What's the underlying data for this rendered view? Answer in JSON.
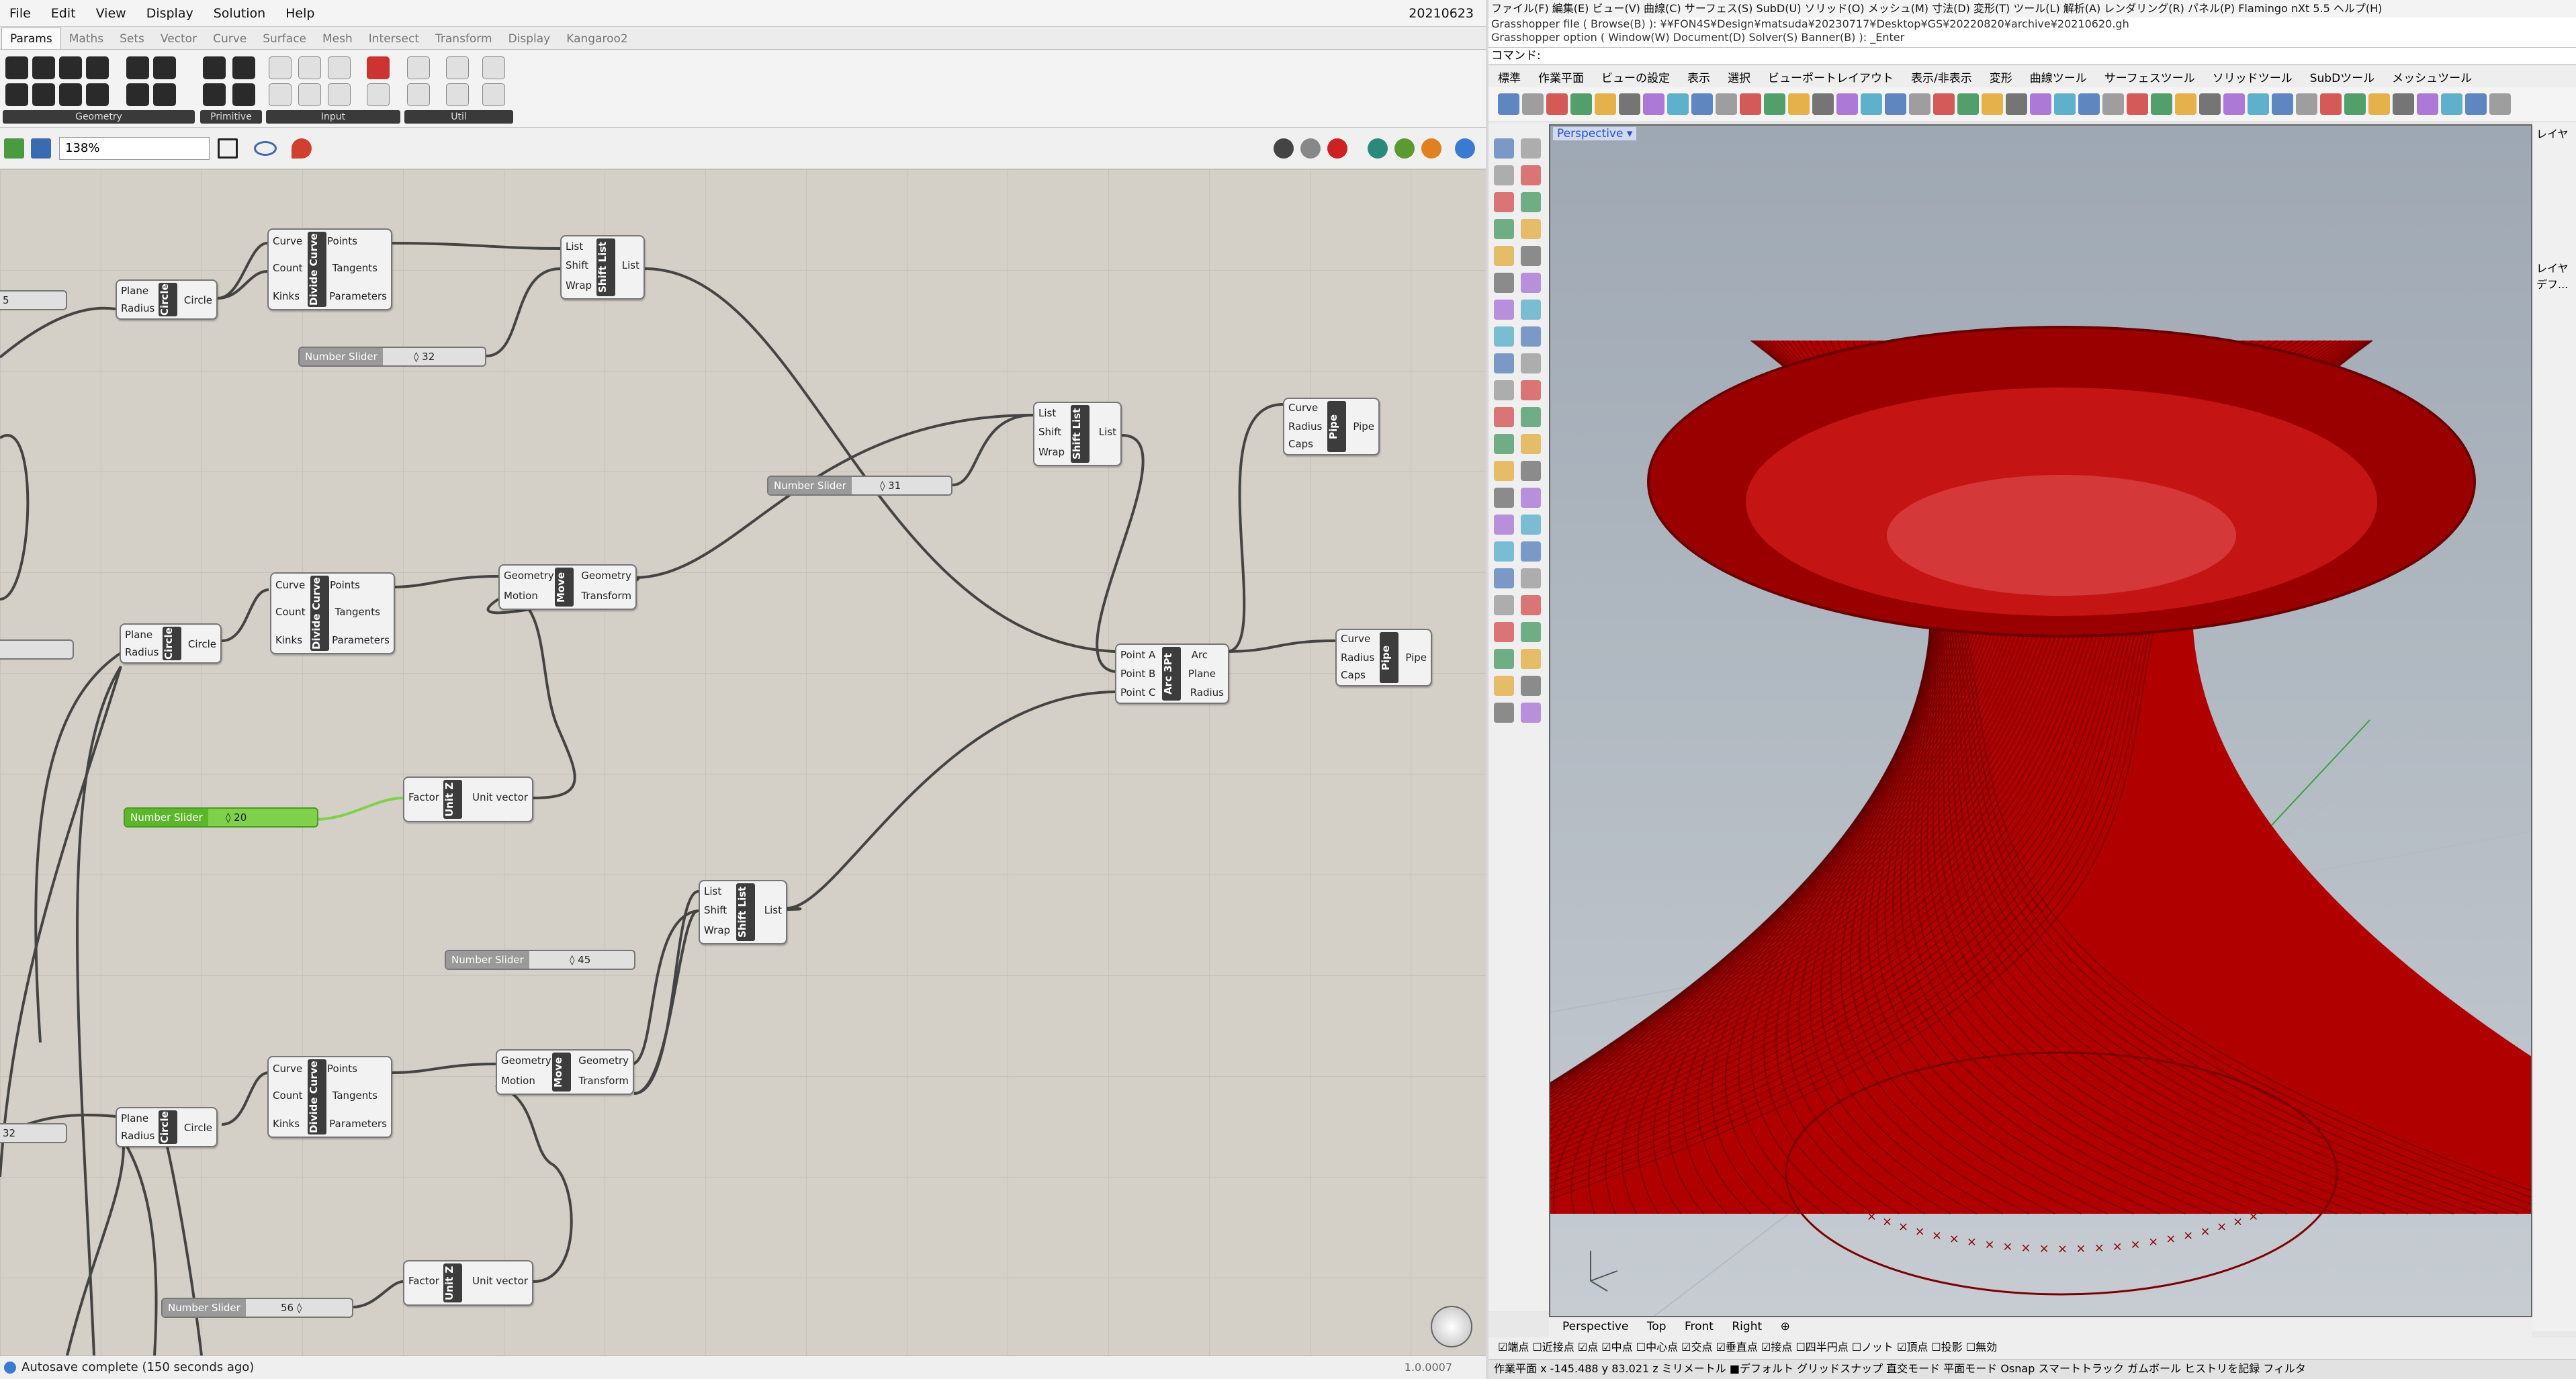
{
  "grasshopper": {
    "menu": [
      "File",
      "Edit",
      "View",
      "Display",
      "Solution",
      "Help"
    ],
    "date": "20210623",
    "tabs": [
      "Params",
      "Maths",
      "Sets",
      "Vector",
      "Curve",
      "Surface",
      "Mesh",
      "Intersect",
      "Transform",
      "Display",
      "Kangaroo2"
    ],
    "ribbon_groups": [
      "Geometry",
      "Primitive",
      "Input",
      "Util"
    ],
    "zoom": "138%",
    "components": [
      {
        "id": "circle1",
        "title": "Circle",
        "inputs": [
          "Plane",
          "Radius"
        ],
        "outputs": [
          "Circle"
        ]
      },
      {
        "id": "divide1",
        "title": "Divide Curve",
        "inputs": [
          "Curve",
          "Count",
          "Kinks"
        ],
        "outputs": [
          "Points",
          "Tangents",
          "Parameters"
        ]
      },
      {
        "id": "shift1",
        "title": "Shift List",
        "inputs": [
          "List",
          "Shift",
          "Wrap"
        ],
        "outputs": [
          "List"
        ]
      },
      {
        "id": "shift2",
        "title": "Shift List",
        "inputs": [
          "List",
          "Shift",
          "Wrap"
        ],
        "outputs": [
          "List"
        ]
      },
      {
        "id": "pipe1",
        "title": "Pipe",
        "inputs": [
          "Curve",
          "Radius",
          "Caps"
        ],
        "outputs": [
          "Pipe"
        ]
      },
      {
        "id": "circle2",
        "title": "Circle",
        "inputs": [
          "Plane",
          "Radius"
        ],
        "outputs": [
          "Circle"
        ]
      },
      {
        "id": "divide2",
        "title": "Divide Curve",
        "inputs": [
          "Curve",
          "Count",
          "Kinks"
        ],
        "outputs": [
          "Points",
          "Tangents",
          "Parameters"
        ]
      },
      {
        "id": "move1",
        "title": "Move",
        "inputs": [
          "Geometry",
          "Motion"
        ],
        "outputs": [
          "Geometry",
          "Transform"
        ]
      },
      {
        "id": "arc",
        "title": "Arc 3Pt",
        "inputs": [
          "Point A",
          "Point B",
          "Point C"
        ],
        "outputs": [
          "Arc",
          "Plane",
          "Radius"
        ]
      },
      {
        "id": "pipe2",
        "title": "Pipe",
        "inputs": [
          "Curve",
          "Radius",
          "Caps"
        ],
        "outputs": [
          "Pipe"
        ]
      },
      {
        "id": "unitz1",
        "title": "Unit Z",
        "inputs": [
          "Factor"
        ],
        "outputs": [
          "Unit vector"
        ]
      },
      {
        "id": "shift3",
        "title": "Shift List",
        "inputs": [
          "List",
          "Shift",
          "Wrap"
        ],
        "outputs": [
          "List"
        ]
      },
      {
        "id": "circle3",
        "title": "Circle",
        "inputs": [
          "Plane",
          "Radius"
        ],
        "outputs": [
          "Circle"
        ]
      },
      {
        "id": "divide3",
        "title": "Divide Curve",
        "inputs": [
          "Curve",
          "Count",
          "Kinks"
        ],
        "outputs": [
          "Points",
          "Tangents",
          "Parameters"
        ]
      },
      {
        "id": "move2",
        "title": "Move",
        "inputs": [
          "Geometry",
          "Motion"
        ],
        "outputs": [
          "Geometry",
          "Transform"
        ]
      },
      {
        "id": "unitz2",
        "title": "Unit Z",
        "inputs": [
          "Factor"
        ],
        "outputs": [
          "Unit vector"
        ]
      }
    ],
    "sliders": [
      {
        "id": "s32",
        "label": "Number Slider",
        "value": "◊ 32"
      },
      {
        "id": "s31",
        "label": "Number Slider",
        "value": "◊ 31"
      },
      {
        "id": "s20",
        "label": "Number Slider",
        "value": "◊ 20"
      },
      {
        "id": "s45",
        "label": "Number Slider",
        "value": "◊ 45"
      },
      {
        "id": "s56",
        "label": "Number Slider",
        "value": "56 ◊"
      }
    ],
    "edge_values": [
      "5",
      "32"
    ],
    "status": "Autosave complete (150 seconds ago)",
    "version": "1.0.0007"
  },
  "rhino": {
    "menu": "ファイル(F)  編集(E)  ビュー(V)  曲線(C)  サーフェス(S)  SubD(U)  ソリッド(O)  メッシュ(M)  寸法(D)  変形(T)  ツール(L)  解析(A)  レンダリング(R)  パネル(P)  Flamingo nXt 5.5  ヘルプ(H)",
    "history1": "Grasshopper file ( Browse(B) ): ¥¥FON4S¥Design¥matsuda¥20230717¥Desktop¥GS¥20220820¥archive¥20210620.gh",
    "history2": "Grasshopper option ( Window(W)  Document(D)  Solver(S)  Banner(B) ): _Enter",
    "command": "コマンド:",
    "tabs": [
      "標準",
      "作業平面",
      "ビューの設定",
      "表示",
      "選択",
      "ビューポートレイアウト",
      "表示/非表示",
      "変形",
      "曲線ツール",
      "サーフェスツール",
      "ソリッドツール",
      "SubDツール",
      "メッシュツール"
    ],
    "viewport_label": "Perspective ▾",
    "viewtabs": [
      "Perspective",
      "Top",
      "Front",
      "Right",
      "⊕"
    ],
    "osnaps": "☑端点  ☐近接点  ☑点  ☑中点  ☐中心点  ☑交点  ☑垂直点  ☑接点  ☐四半円点  ☐ノット  ☑頂点  ☐投影        ☐無効",
    "status": "作業平面    x -145.488    y 83.021         z         ミリメートル    ■デフォルト                     グリッドスナップ  直交モード  平面モード  Osnap  スマートトラック  ガムボール  ヒストリを記録  フィルタ",
    "right_panel": [
      "レイヤ",
      "レイヤ",
      "デフ..."
    ]
  },
  "colors": {
    "geometry_red": "#b00000",
    "slider_green": "#7fd14b",
    "component_title": "#3c3c3c"
  }
}
